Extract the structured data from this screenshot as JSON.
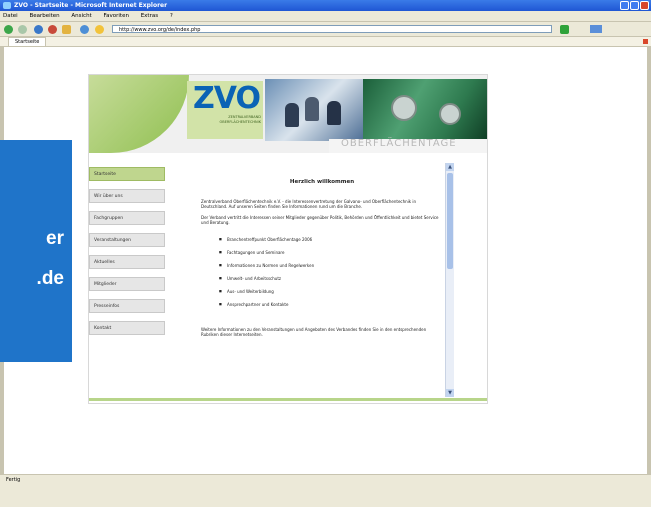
{
  "browser": {
    "window_title": "ZVO - Startseite - Microsoft Internet Explorer",
    "menu": [
      "Datei",
      "Bearbeiten",
      "Ansicht",
      "Favoriten",
      "Extras",
      "?"
    ],
    "address": "http://www.zvo.org/de/index.php",
    "tab_title": "Startseite",
    "status": "Fertig"
  },
  "site": {
    "logo": "ZVO",
    "logo_sub": "ZENTRALVERBAND OBERFLÄCHENTECHNIK",
    "header_word": "OBERFLÄCHENTAGE",
    "nav": [
      "Startseite",
      "Wir über uns",
      "Fachgruppen",
      "Veranstaltungen",
      "Aktuelles",
      "Mitglieder",
      "Presseinfos",
      "Kontakt"
    ],
    "content_title": "Herzlich willkommen",
    "para1": "Zentralverband Oberflächentechnik e.V. - die Interessenvertretung der Galvano- und Oberflächentechnik in Deutschland. Auf unseren Seiten finden Sie Informationen rund um die Branche.",
    "para2": "Der Verband vertritt die Interessen seiner Mitglieder gegenüber Politik, Behörden und Öffentlichkeit und bietet Service und Beratung.",
    "list": [
      "Branchentreffpunkt Oberflächentage 2006",
      "Fachtagungen und Seminare",
      "Informationen zu Normen und Regelwerken",
      "Umwelt- und Arbeitsschutz",
      "Aus- und Weiterbildung",
      "Ansprechpartner und Kontakte"
    ],
    "footer_text": "Weitere Informationen zu den Veranstaltungen und Angeboten des Verbandes finden Sie in den entsprechenden Rubriken dieser Internetseiten."
  },
  "callout": {
    "line1": "er",
    "line2": ".de"
  }
}
